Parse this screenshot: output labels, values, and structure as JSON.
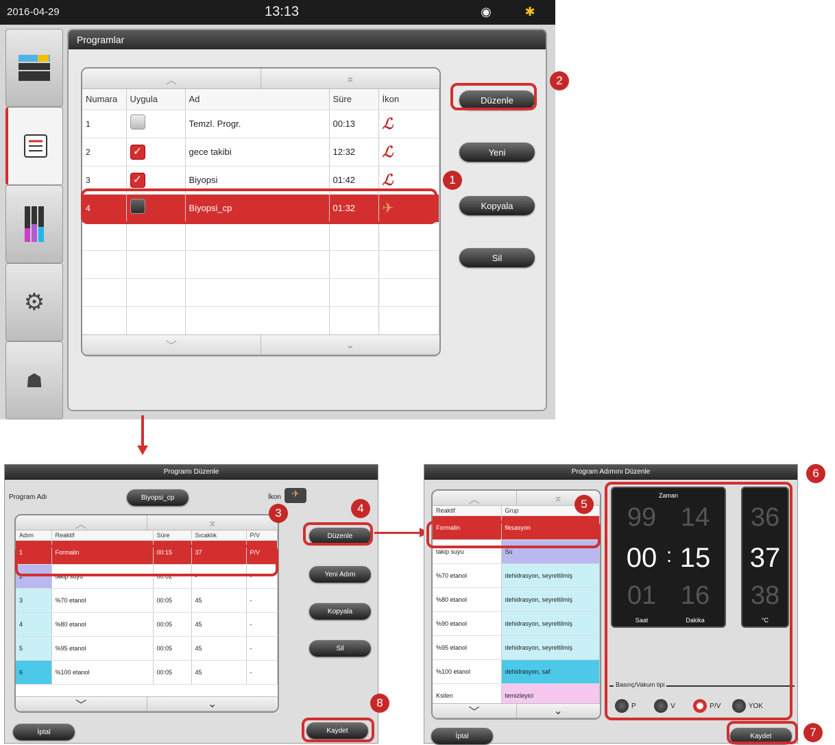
{
  "top": {
    "date": "2016-04-29",
    "time": "13:13",
    "title": "Programlar",
    "columns": [
      "Numara",
      "Uygula",
      "Ad",
      "Süre",
      "İkon"
    ],
    "rows": [
      {
        "num": "1",
        "name": "Temzl. Progr.",
        "dur": "00:13",
        "apply": "off"
      },
      {
        "num": "2",
        "name": "gece takibi",
        "dur": "12:32",
        "apply": "on"
      },
      {
        "num": "3",
        "name": "Biyopsi",
        "dur": "01:42",
        "apply": "on"
      },
      {
        "num": "4",
        "name": "Biyopsi_cp",
        "dur": "01:32",
        "apply": "dark"
      }
    ],
    "buttons": {
      "edit": "Düzenle",
      "new": "Yeni",
      "copy": "Kopyala",
      "delete": "Sil"
    }
  },
  "edit": {
    "title": "Programı Düzenle",
    "name_label": "Program Adı",
    "name_value": "Biyopsi_cp",
    "icon_label": "İkon",
    "columns": [
      "Adım",
      "Reaktif",
      "Süre",
      "Sıcaklık",
      "P/V"
    ],
    "rows": [
      {
        "n": "1",
        "reagent": "Formalin",
        "dur": "00:15",
        "temp": "37",
        "pv": "P/V"
      },
      {
        "n": "2",
        "reagent": "takip suyu",
        "dur": "00:02",
        "temp": "-",
        "pv": "-"
      },
      {
        "n": "3",
        "reagent": "%70 etanol",
        "dur": "00:05",
        "temp": "45",
        "pv": "-"
      },
      {
        "n": "4",
        "reagent": "%80 etanol",
        "dur": "00:05",
        "temp": "45",
        "pv": "-"
      },
      {
        "n": "5",
        "reagent": "%95 etanol",
        "dur": "00:05",
        "temp": "45",
        "pv": "-"
      },
      {
        "n": "6",
        "reagent": "%100 etanol",
        "dur": "00:05",
        "temp": "45",
        "pv": "-"
      }
    ],
    "buttons": {
      "edit": "Düzenle",
      "new_step": "Yeni Adım",
      "copy": "Kopyala",
      "delete": "Sil",
      "cancel": "İptal",
      "save": "Kaydet"
    }
  },
  "step": {
    "title": "Program Adımını Düzenle",
    "columns": [
      "Reaktif",
      "Grup"
    ],
    "rows": [
      {
        "reagent": "Formalin",
        "group": "fiksasyon"
      },
      {
        "reagent": "takip suyu",
        "group": "Su"
      },
      {
        "reagent": "%70 etanol",
        "group": "dehidrasyon, seyreltilmiş"
      },
      {
        "reagent": "%80 etanol",
        "group": "dehidrasyon, seyreltilmiş"
      },
      {
        "reagent": "%90 etanol",
        "group": "dehidrasyon, seyreltilmiş"
      },
      {
        "reagent": "%95 etanol",
        "group": "dehidrasyon, seyreltilmiş"
      },
      {
        "reagent": "%100 etanol",
        "group": "dehidrasyon, saf"
      },
      {
        "reagent": "Ksilen",
        "group": "temizleyici"
      }
    ],
    "time_label": "Zaman",
    "hour_label": "Saat",
    "min_label": "Dakika",
    "temp_unit": "°C",
    "hours": {
      "prev": "99",
      "cur": "00",
      "next": "01"
    },
    "minutes": {
      "prev": "14",
      "cur": "15",
      "next": "16"
    },
    "temp": {
      "prev": "36",
      "cur": "37",
      "next": "38"
    },
    "pv_label": "Basınç/Vakum tipi",
    "pv_options": [
      "P",
      "V",
      "P/V",
      "YOK"
    ],
    "buttons": {
      "cancel": "İptal",
      "save": "Kaydet"
    }
  },
  "callouts": [
    "1",
    "2",
    "3",
    "4",
    "5",
    "6",
    "7",
    "8"
  ]
}
